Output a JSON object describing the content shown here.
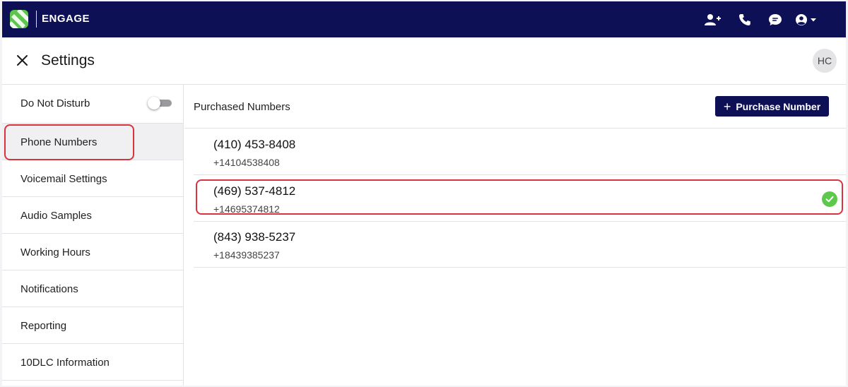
{
  "app": {
    "brand": "ENGAGE",
    "logo_icon": "engage-logo-icon",
    "colors": {
      "navbar": "#0e1056",
      "logo": "#5cc64b",
      "primary_button": "#0e1056",
      "success": "#5dc94c",
      "highlight": "#d9333f"
    },
    "top_icons": [
      "add-contact-icon",
      "phone-icon",
      "chat-icon",
      "account-icon"
    ]
  },
  "header": {
    "title": "Settings",
    "avatar_initials": "HC"
  },
  "sidebar": {
    "items": [
      {
        "label": "Do Not Disturb",
        "toggle": false
      },
      {
        "label": "Phone Numbers",
        "active": true
      },
      {
        "label": "Voicemail Settings"
      },
      {
        "label": "Audio Samples"
      },
      {
        "label": "Working Hours"
      },
      {
        "label": "Notifications"
      },
      {
        "label": "Reporting"
      },
      {
        "label": "10DLC Information"
      }
    ]
  },
  "main": {
    "title": "Purchased Numbers",
    "purchase_button_label": "Purchase Number",
    "numbers": [
      {
        "formatted": "(410) 453-8408",
        "e164": "+14104538408",
        "selected": false
      },
      {
        "formatted": "(469) 537-4812",
        "e164": "+14695374812",
        "selected": true
      },
      {
        "formatted": "(843) 938-5237",
        "e164": "+18439385237",
        "selected": false
      }
    ]
  }
}
